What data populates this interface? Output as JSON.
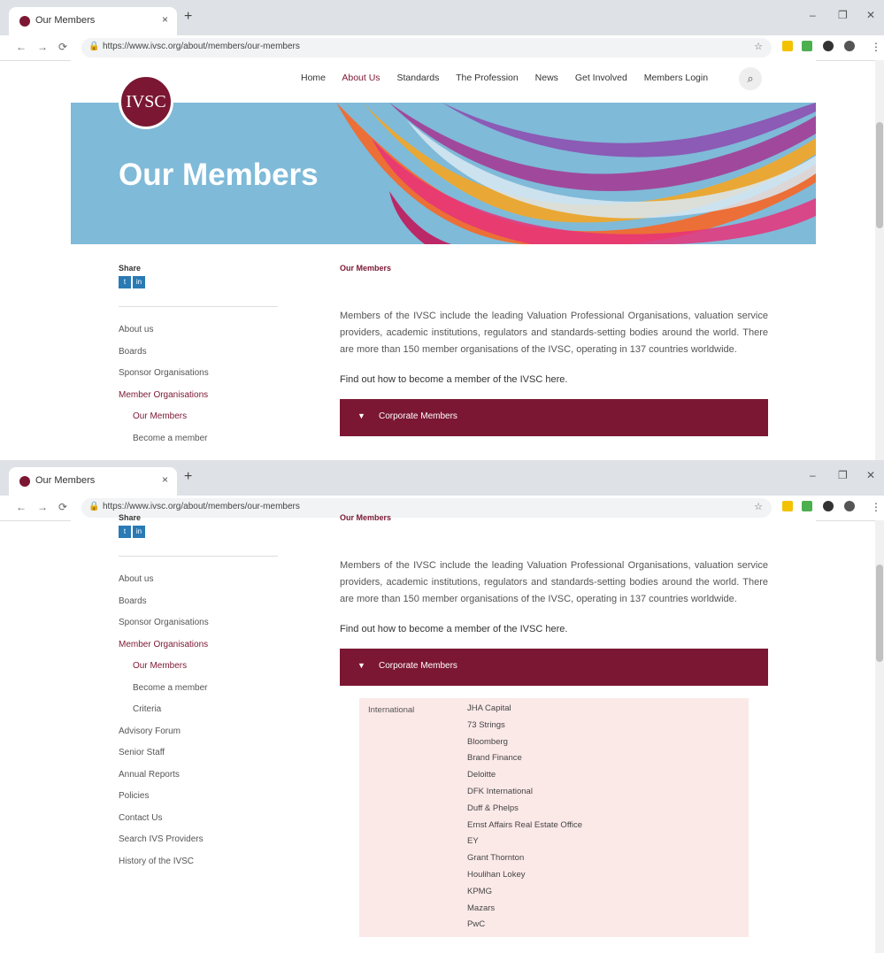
{
  "browser": {
    "tab_title": "Our Members",
    "tab_close": "×",
    "new_tab": "+",
    "minimize": "–",
    "maximize": "❐",
    "close": "✕",
    "back": "←",
    "forward": "→",
    "reload": "⟳",
    "lock": "🔒",
    "url": "https://www.ivsc.org/about/members/our-members",
    "omni_icons": "☆",
    "menu": "⋮"
  },
  "site": {
    "logo_text": "IVSC",
    "nav": [
      "Home",
      "About Us",
      "Standards",
      "The Profession",
      "News",
      "Get Involved",
      "Members Login"
    ],
    "search_glyph": "⌕",
    "hero_title": "Our Members"
  },
  "sidebar": {
    "share_label": "Share",
    "twitter": "t",
    "linkedin": "in",
    "items": [
      {
        "label": "About us"
      },
      {
        "label": "Boards"
      },
      {
        "label": "Sponsor Organisations"
      },
      {
        "label": "Member Organisations"
      },
      {
        "label": "Our Members"
      },
      {
        "label": "Become a member"
      },
      {
        "label": "Criteria"
      },
      {
        "label": "Advisory Forum"
      },
      {
        "label": "Senior Staff"
      },
      {
        "label": "Annual Reports"
      },
      {
        "label": "Policies"
      },
      {
        "label": "Contact Us"
      },
      {
        "label": "Search IVS Providers"
      },
      {
        "label": "History of the IVSC"
      }
    ]
  },
  "main": {
    "breadcrumb": "Our Members",
    "intro": "Members of the IVSC include the leading Valuation Professional Organisations, valuation service providers, academic institutions, regulators and standards-setting bodies around the world. There are more than 150 member organisations of the IVSC, operating in 137 countries worldwide.",
    "find_out": "Find out how to become a member of the IVSC here.",
    "accordion_caret": "▼",
    "accordion_label": "Corporate Members",
    "region_label": "International",
    "members": [
      "JHA Capital",
      "73 Strings",
      "Bloomberg",
      "Brand Finance",
      "Deloitte",
      "DFK International",
      "Duff & Phelps",
      "Ernst Affairs Real Estate Office",
      "EY",
      "Grant Thornton",
      "Houlihan Lokey",
      "KPMG",
      "Mazars",
      "PwC"
    ]
  }
}
